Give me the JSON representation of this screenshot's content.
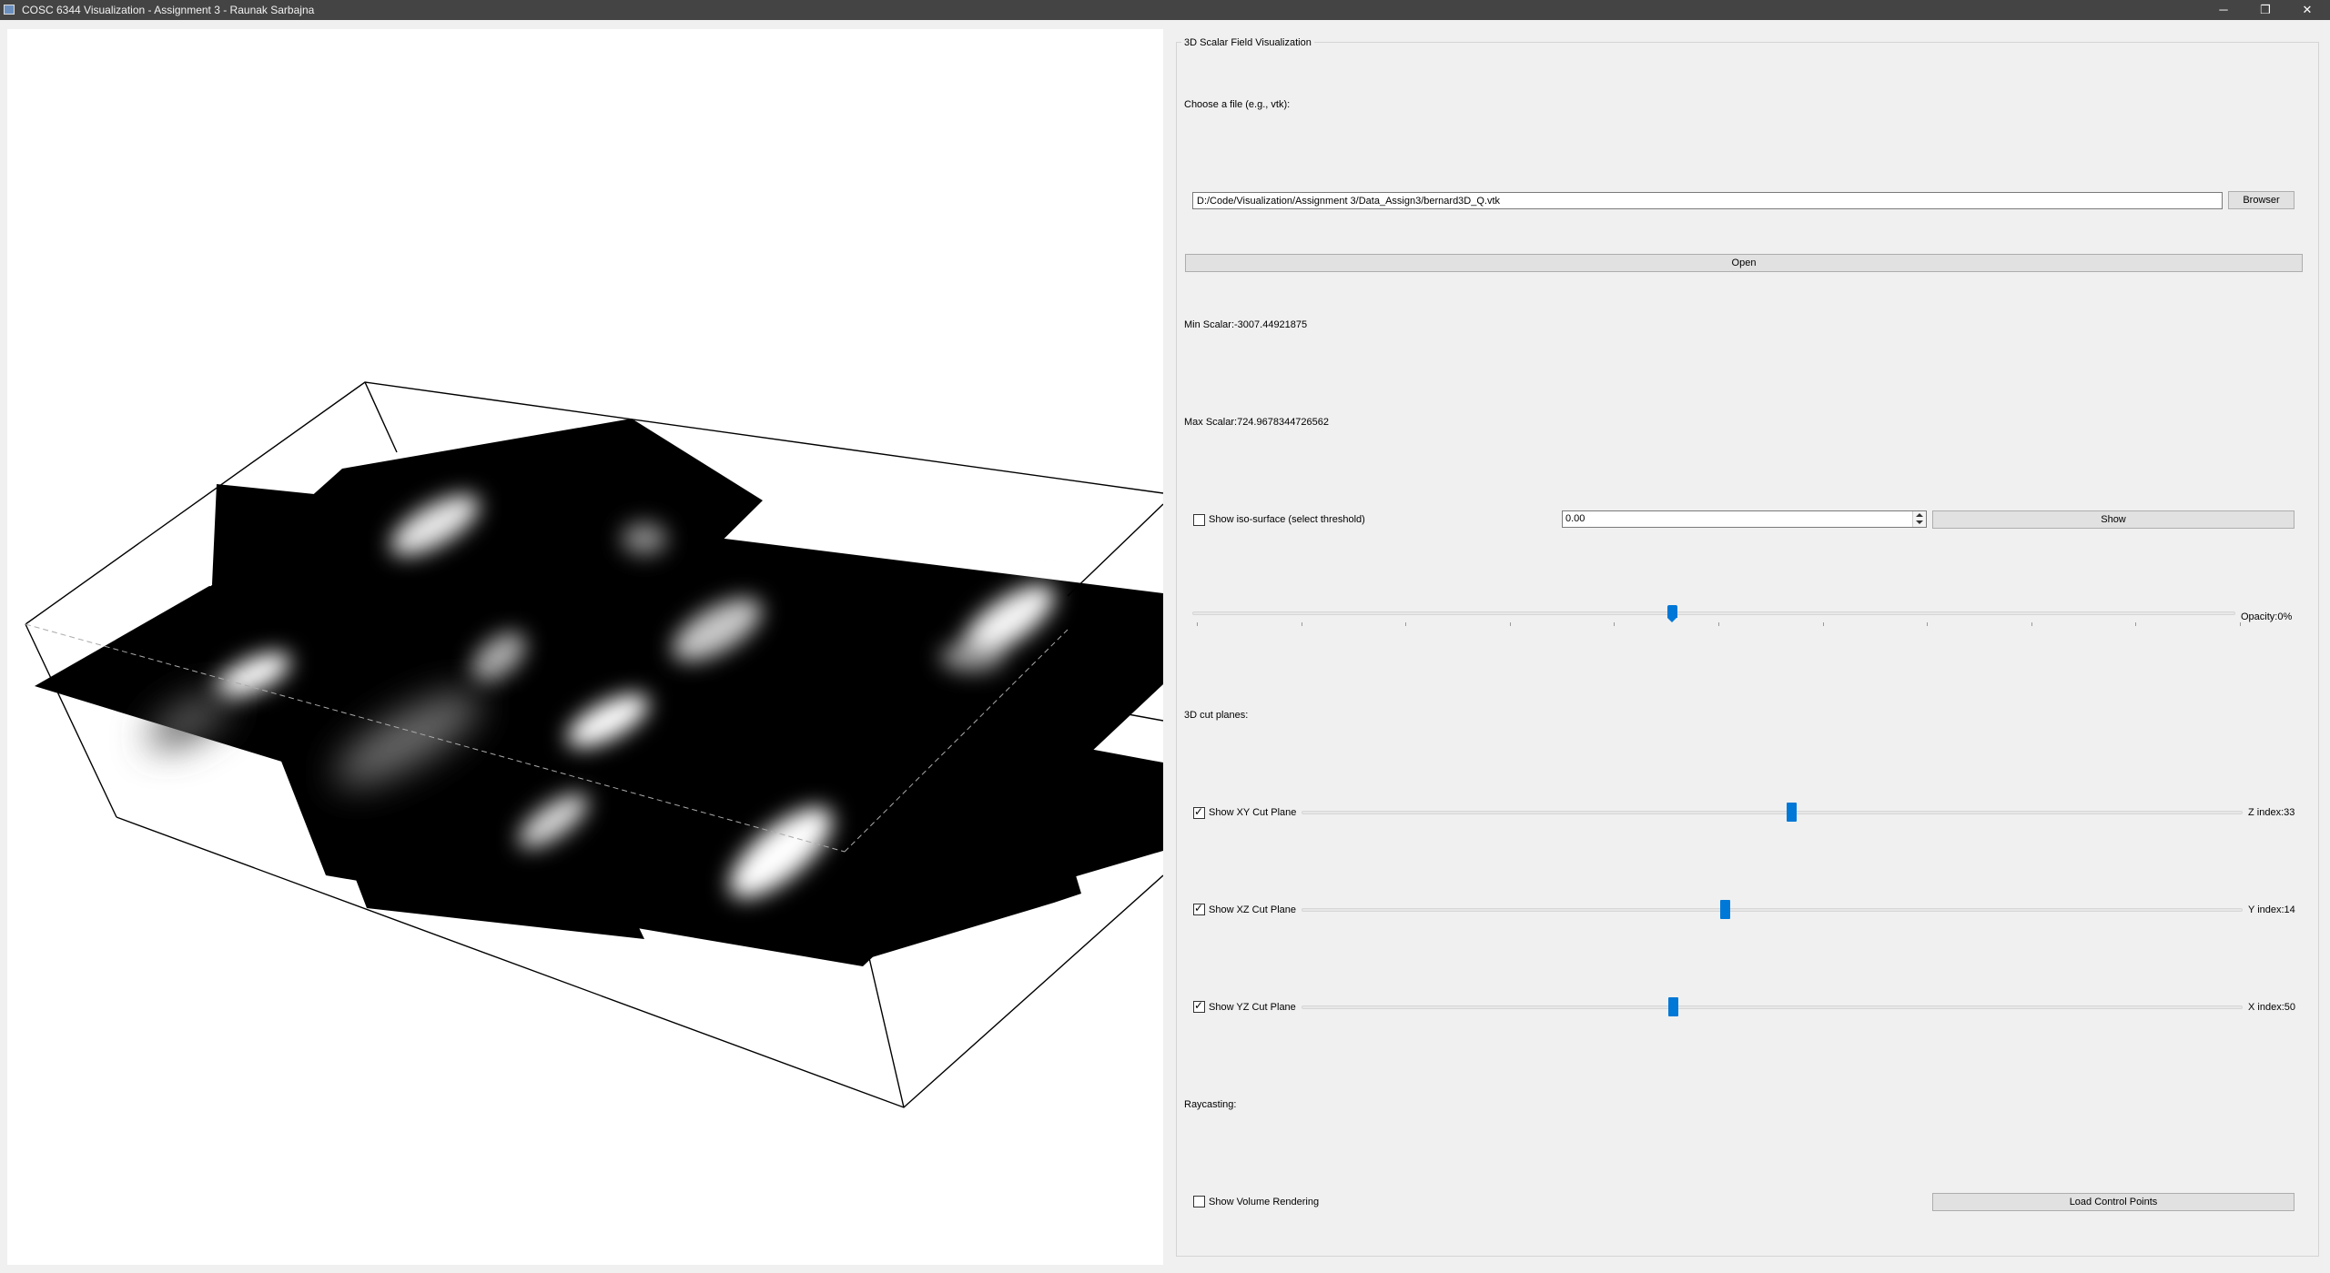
{
  "window": {
    "title": "COSC 6344 Visualization - Assignment 3 - Raunak Sarbajna",
    "minimize_glyph": "─",
    "maximize_glyph": "❐",
    "close_glyph": "✕"
  },
  "panel": {
    "group_title": "3D Scalar Field Visualization",
    "file_label": "Choose a file (e.g., vtk):",
    "file_path": "D:/Code/Visualization/Assignment 3/Data_Assign3/bernard3D_Q.vtk",
    "browse_button": "Browser",
    "open_button": "Open",
    "min_scalar": "Min Scalar:-3007.44921875",
    "max_scalar": "Max Scalar:724.9678344726562",
    "iso_checkbox_label": "Show iso-surface (select threshold)",
    "iso_checked": false,
    "iso_threshold": "0.00",
    "show_button": "Show",
    "opacity_label": "Opacity:0%",
    "opacity_slider_position": 0.46,
    "cut_planes_heading": "3D cut planes:",
    "xy": {
      "label": "Show XY Cut Plane",
      "checked": true,
      "index_label": "Z index:33",
      "position": 0.52
    },
    "xz": {
      "label": "Show XZ Cut Plane",
      "checked": true,
      "index_label": "Y index:14",
      "position": 0.45
    },
    "yz": {
      "label": "Show YZ Cut Plane",
      "checked": true,
      "index_label": "X index:50",
      "position": 0.395
    },
    "raycasting_heading": "Raycasting:",
    "volume_checkbox_label": "Show Volume Rendering",
    "volume_checked": false,
    "load_button": "Load Control Points"
  },
  "colors": {
    "titlebar": "#444444",
    "accent": "#0078d7",
    "panel_bg": "#f0f0f0",
    "viewport_bg": "#ffffff"
  },
  "icons": {
    "app": "app-icon",
    "spin_up": "arrow-up-icon",
    "spin_down": "arrow-down-icon",
    "check": "check-icon"
  }
}
